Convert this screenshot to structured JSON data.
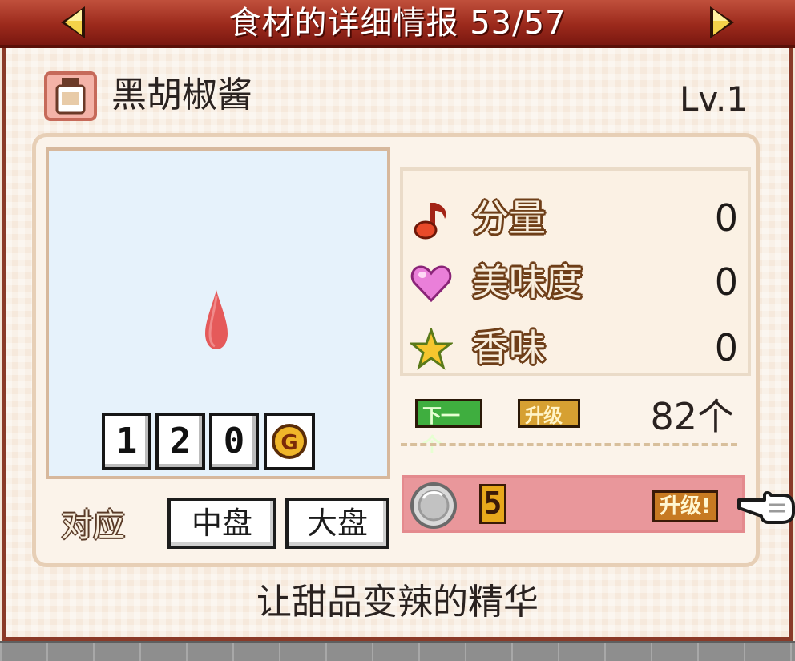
{
  "header": {
    "title": "食材的详细情报 53/57"
  },
  "ingredient": {
    "name": "黑胡椒酱",
    "level": "Lv.1",
    "description": "让甜品变辣的精华"
  },
  "price": {
    "digits": [
      "1",
      "2",
      "0"
    ],
    "currency_icon": "gold-coin-g-icon"
  },
  "stats": [
    {
      "icon": "music-note-icon",
      "label": "分量",
      "value": "0"
    },
    {
      "icon": "heart-icon",
      "label": "美味度",
      "value": "0"
    },
    {
      "icon": "star-icon",
      "label": "香味",
      "value": "0"
    }
  ],
  "upgrade": {
    "next_label": "下一个",
    "upgrade_label": "升级",
    "count": "82个",
    "cost": "5",
    "button_label": "升级!"
  },
  "plates": {
    "label": "对应",
    "options": [
      "中盘",
      "大盘"
    ]
  },
  "colors": {
    "header": "#9c2a1c",
    "upgrade_bar": "#e9979b",
    "preview_bg": "#e6f2fb"
  }
}
